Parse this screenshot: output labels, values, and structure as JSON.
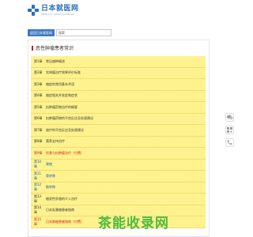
{
  "header": {
    "logo_title": "日本就医网",
    "logo_subtitle": "MEDICAL JAPAN SUPPORT"
  },
  "toolbar": {
    "site_button": "返回日本就医网",
    "search_value": "搜索"
  },
  "section": {
    "title": "恶性肿瘤患者常识"
  },
  "chapters": [
    {
      "num": "第1章",
      "title": "常见癌种概述",
      "color": "normal"
    },
    {
      "num": "第2章",
      "title": "实体瘤治疗效果评价标准",
      "color": "normal"
    },
    {
      "num": "第3章",
      "title": "癌症的常用基本术语",
      "color": "normal"
    },
    {
      "num": "第4章",
      "title": "癌症相关并发症和症状",
      "color": "normal"
    },
    {
      "num": "第5章",
      "title": "抗肿瘤药物治疗的概要",
      "color": "normal"
    },
    {
      "num": "第6章",
      "title": "抗肿瘤药物的不良反应及处理建议",
      "color": "normal"
    },
    {
      "num": "第7章",
      "title": "放疗的不良反应及处理建议",
      "color": "normal"
    },
    {
      "num": "第8章",
      "title": "营养支持治疗",
      "color": "normal"
    },
    {
      "num": "第9章",
      "title": "饮食与抗肿瘤治疗（付费）",
      "color": "red"
    },
    {
      "num": "第10章",
      "title": "胃癌",
      "color": "blue"
    },
    {
      "num": "第11章",
      "title": "骨转移",
      "color": "blue"
    },
    {
      "num": "第12章",
      "title": "脑转移",
      "color": "blue"
    },
    {
      "num": "第13章",
      "title": "癌发性肝癌的介入治疗",
      "color": "normal"
    },
    {
      "num": "第14章",
      "title": "日本乳腺癌患者指南",
      "color": "normal"
    },
    {
      "num": "第15章",
      "title": "日本肺癌患者指南（付费）",
      "color": "red"
    }
  ],
  "icons": {
    "wechat": "wechat-icon",
    "qr": "qrcode-icon",
    "phone": "phone-icon"
  },
  "watermark": "茶能收录网"
}
